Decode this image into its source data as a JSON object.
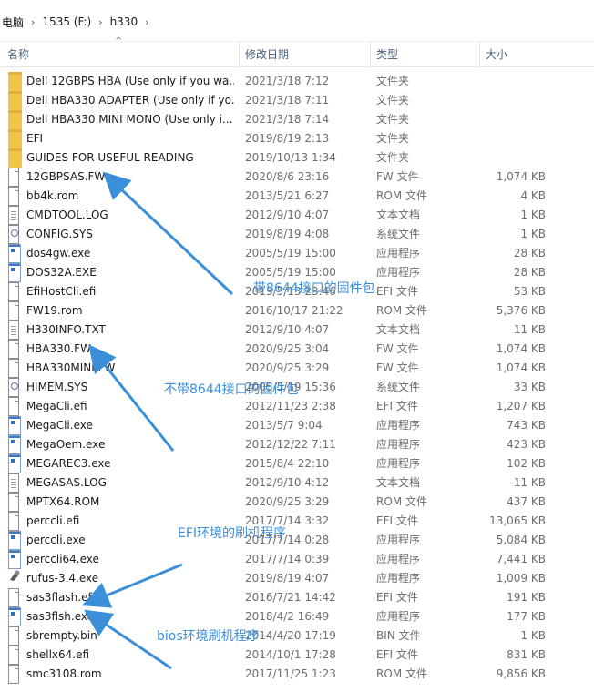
{
  "breadcrumb": [
    "电脑",
    "1535 (F:)",
    "h330"
  ],
  "columns": {
    "name": "名称",
    "date": "修改日期",
    "type": "类型",
    "size": "大小"
  },
  "files": [
    {
      "name": "Dell 12GBPS HBA (Use only if you wa...",
      "date": "2021/3/18 7:12",
      "type": "文件夹",
      "size": "",
      "icon": "folder-icon"
    },
    {
      "name": "Dell HBA330 ADAPTER (Use only if yo...",
      "date": "2021/3/18 7:11",
      "type": "文件夹",
      "size": "",
      "icon": "folder-icon"
    },
    {
      "name": "Dell HBA330 MINI MONO (Use only i...",
      "date": "2021/3/18 7:14",
      "type": "文件夹",
      "size": "",
      "icon": "folder-icon"
    },
    {
      "name": "EFI",
      "date": "2019/8/19 2:13",
      "type": "文件夹",
      "size": "",
      "icon": "folder-icon"
    },
    {
      "name": "GUIDES FOR USEFUL READING",
      "date": "2019/10/13 1:34",
      "type": "文件夹",
      "size": "",
      "icon": "folder-icon"
    },
    {
      "name": "12GBPSAS.FW",
      "date": "2020/8/6 23:16",
      "type": "FW 文件",
      "size": "1,074 KB",
      "icon": "file-icon"
    },
    {
      "name": "bb4k.rom",
      "date": "2013/5/21 6:27",
      "type": "ROM 文件",
      "size": "4 KB",
      "icon": "file-icon"
    },
    {
      "name": "CMDTOOL.LOG",
      "date": "2012/9/10 4:07",
      "type": "文本文档",
      "size": "1 KB",
      "icon": "text-file-icon"
    },
    {
      "name": "CONFIG.SYS",
      "date": "2019/8/19 4:08",
      "type": "系统文件",
      "size": "1 KB",
      "icon": "system-file-icon"
    },
    {
      "name": "dos4gw.exe",
      "date": "2005/5/19 15:00",
      "type": "应用程序",
      "size": "28 KB",
      "icon": "application-icon"
    },
    {
      "name": "DOS32A.EXE",
      "date": "2005/5/19 15:00",
      "type": "应用程序",
      "size": "28 KB",
      "icon": "application-icon"
    },
    {
      "name": "EfiHostCli.efi",
      "date": "2013/5/13 23:46",
      "type": "EFI 文件",
      "size": "53 KB",
      "icon": "file-icon"
    },
    {
      "name": "FW19.rom",
      "date": "2016/10/17 21:22",
      "type": "ROM 文件",
      "size": "5,376 KB",
      "icon": "file-icon"
    },
    {
      "name": "H330INFO.TXT",
      "date": "2012/9/10 4:07",
      "type": "文本文档",
      "size": "11 KB",
      "icon": "text-file-icon"
    },
    {
      "name": "HBA330.FW",
      "date": "2020/9/25 3:04",
      "type": "FW 文件",
      "size": "1,074 KB",
      "icon": "file-icon"
    },
    {
      "name": "HBA330MINI.FW",
      "date": "2020/9/25 3:29",
      "type": "FW 文件",
      "size": "1,074 KB",
      "icon": "file-icon"
    },
    {
      "name": "HIMEM.SYS",
      "date": "2005/5/19 15:36",
      "type": "系统文件",
      "size": "33 KB",
      "icon": "system-file-icon"
    },
    {
      "name": "MegaCli.efi",
      "date": "2012/11/23 2:38",
      "type": "EFI 文件",
      "size": "1,207 KB",
      "icon": "file-icon"
    },
    {
      "name": "MegaCli.exe",
      "date": "2013/5/7 9:04",
      "type": "应用程序",
      "size": "743 KB",
      "icon": "application-icon"
    },
    {
      "name": "MegaOem.exe",
      "date": "2012/12/22 7:11",
      "type": "应用程序",
      "size": "423 KB",
      "icon": "application-icon"
    },
    {
      "name": "MEGAREC3.exe",
      "date": "2015/8/4 22:10",
      "type": "应用程序",
      "size": "102 KB",
      "icon": "application-icon"
    },
    {
      "name": "MEGASAS.LOG",
      "date": "2012/9/10 4:12",
      "type": "文本文档",
      "size": "11 KB",
      "icon": "text-file-icon"
    },
    {
      "name": "MPTX64.ROM",
      "date": "2020/9/25 3:29",
      "type": "ROM 文件",
      "size": "437 KB",
      "icon": "file-icon"
    },
    {
      "name": "perccli.efi",
      "date": "2017/7/14 3:32",
      "type": "EFI 文件",
      "size": "13,065 KB",
      "icon": "file-icon"
    },
    {
      "name": "perccli.exe",
      "date": "2017/7/14 0:28",
      "type": "应用程序",
      "size": "5,084 KB",
      "icon": "application-icon"
    },
    {
      "name": "perccli64.exe",
      "date": "2017/7/14 0:39",
      "type": "应用程序",
      "size": "7,441 KB",
      "icon": "application-icon"
    },
    {
      "name": "rufus-3.4.exe",
      "date": "2019/8/19 4:07",
      "type": "应用程序",
      "size": "1,009 KB",
      "icon": "rufus-icon"
    },
    {
      "name": "sas3flash.efi",
      "date": "2016/7/21 14:42",
      "type": "EFI 文件",
      "size": "191 KB",
      "icon": "file-icon"
    },
    {
      "name": "sas3flsh.exe",
      "date": "2018/4/2 16:49",
      "type": "应用程序",
      "size": "177 KB",
      "icon": "application-icon"
    },
    {
      "name": "sbrempty.bin",
      "date": "2014/4/20 17:19",
      "type": "BIN 文件",
      "size": "1 KB",
      "icon": "file-icon"
    },
    {
      "name": "shellx64.efi",
      "date": "2014/10/1 17:28",
      "type": "EFI 文件",
      "size": "831 KB",
      "icon": "file-icon"
    },
    {
      "name": "smc3108.rom",
      "date": "2017/11/25 1:23",
      "type": "ROM 文件",
      "size": "9,856 KB",
      "icon": "file-icon"
    }
  ],
  "annotations": {
    "with_8644": "带8644接口的固件包",
    "without_8644": "不带8644接口的固件包",
    "efi_flash": "EFI环境的刷机程序",
    "bios_flash": "bios环境刷机程序"
  },
  "colors": {
    "annotation": "#3b8fd9",
    "folder": "#f0c64a",
    "header_text": "#4c607a"
  }
}
